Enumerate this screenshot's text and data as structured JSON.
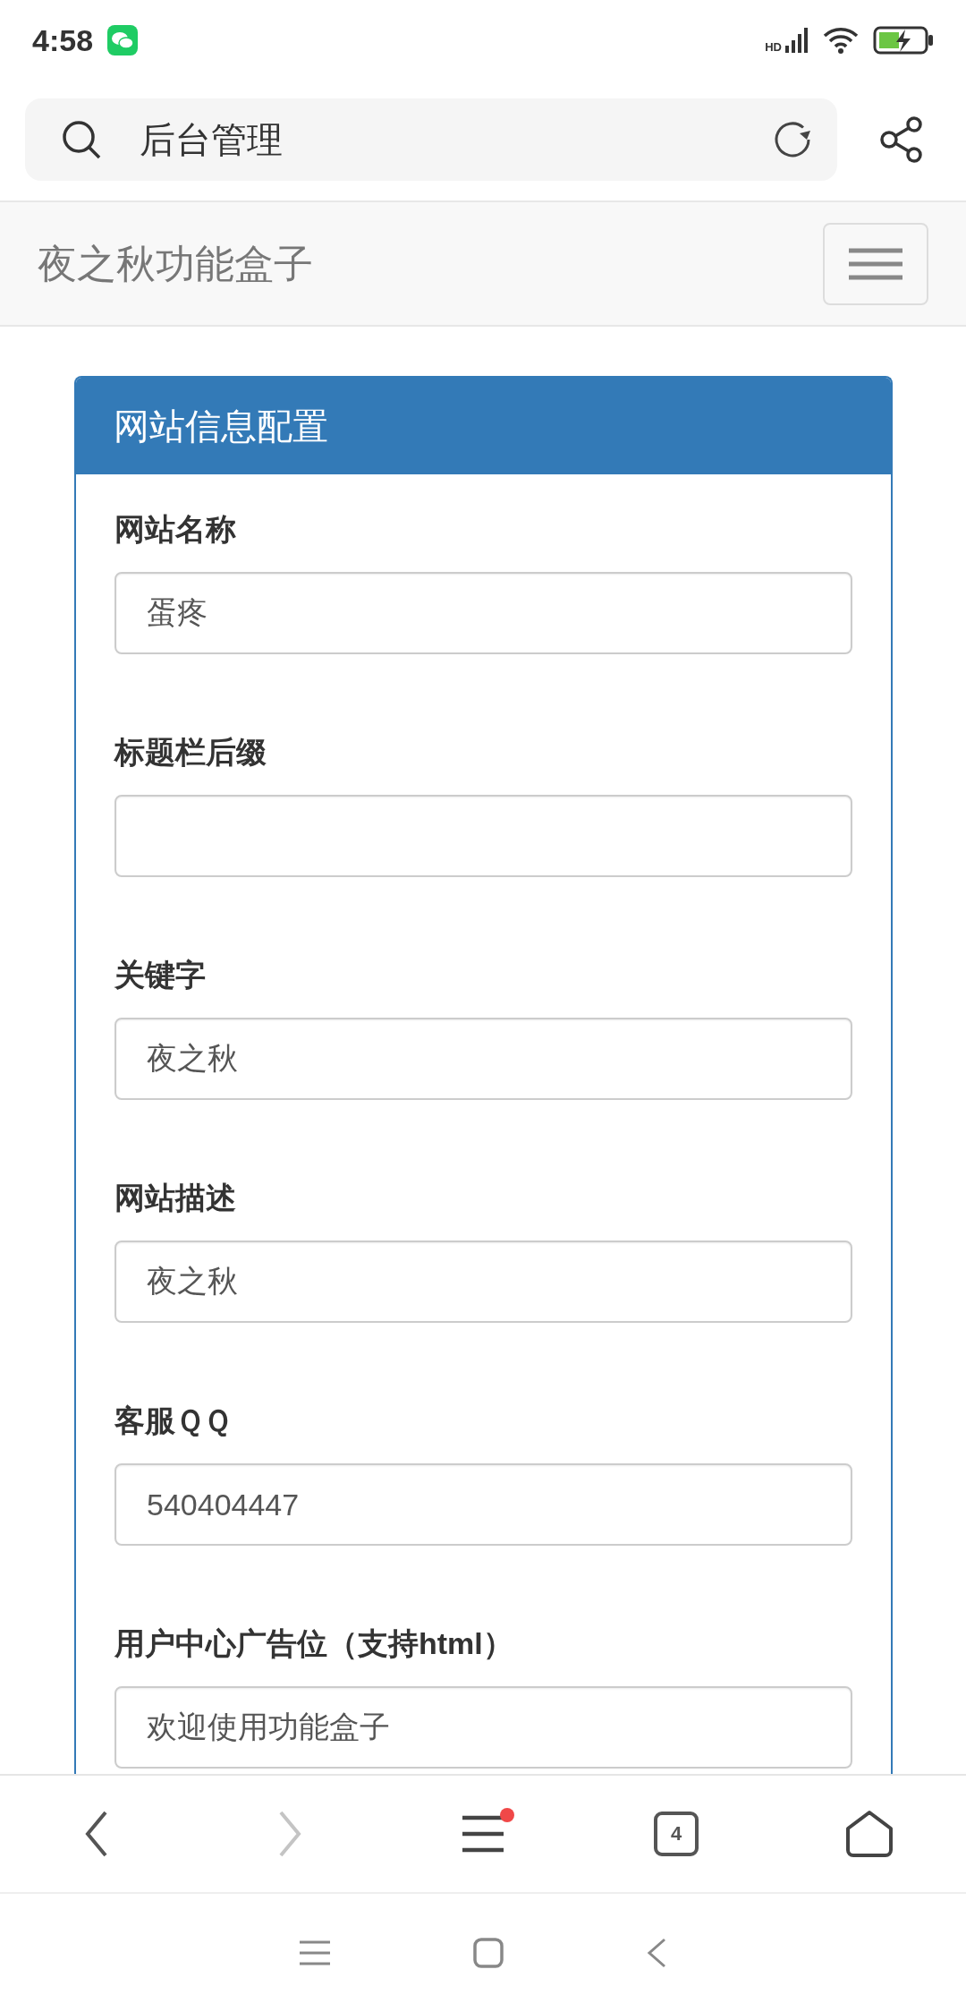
{
  "status_bar": {
    "time": "4:58",
    "network": "HD"
  },
  "address_bar": {
    "text": "后台管理"
  },
  "navbar": {
    "brand": "夜之秋功能盒子"
  },
  "panel": {
    "title": "网站信息配置",
    "fields": [
      {
        "label": "网站名称",
        "value": "蛋疼"
      },
      {
        "label": "标题栏后缀"
      },
      {
        "label": "关键字",
        "value": "夜之秋"
      },
      {
        "label": "网站描述",
        "value": "夜之秋"
      },
      {
        "label": "客服ＱＱ",
        "value": "540404447"
      },
      {
        "label": "用户中心广告位（支持html）",
        "value": "欢迎使用功能盒子"
      }
    ]
  },
  "browser_toolbar": {
    "tab_count": "4",
    "menu_notification": true,
    "forward_disabled": true
  }
}
